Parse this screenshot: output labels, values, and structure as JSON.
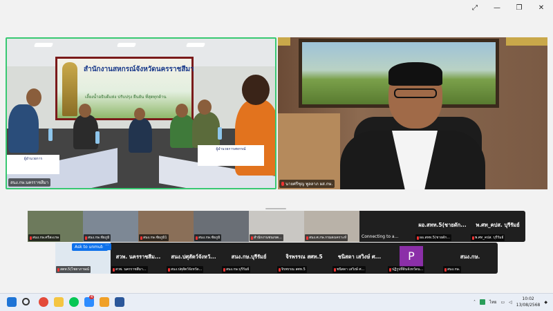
{
  "window": {
    "controls": [
      "⤢",
      "—",
      "❐",
      "✕"
    ]
  },
  "main_tiles": {
    "left": {
      "label": "สนง.กษ.นครราชสีมา",
      "banner_title": "สำนักงานสหกรณ์จังหวัดนครราชสีมา",
      "banner_sub": "เลี้ยงน้ำอธิบดีแห่ง  ปรับปรุง  ยืนยัน  ที่สุดทุกด้าน",
      "nameplate_1": "ผู้อำนวยการ",
      "nameplate_2": "ผู้อำนวยการสหกรณ์"
    },
    "right": {
      "label": "นายศรีชุญ พูลลาภ ผส.กษ."
    }
  },
  "strip_top": [
    {
      "label": "สนง.กษ.ศรีสะเกษ",
      "kind": "video",
      "color": "#6d7a5c"
    },
    {
      "label": "สนง.กษ.ชัยภูมิ",
      "kind": "video",
      "color": "#7d8895"
    },
    {
      "label": "สนง.กษ.ชัยภูมิ1",
      "kind": "video",
      "color": "#8a6f58"
    },
    {
      "label": "สนง.กษ.ชัยภูมิ",
      "kind": "video",
      "color": "#6a6f76"
    },
    {
      "label": "สำนักงานชนเขต...",
      "kind": "video",
      "color": "#c9c7c3"
    },
    {
      "label": "สนง.ศ.กษ.กรมสงเคราะห์",
      "kind": "video",
      "color": "#b9b2a8"
    },
    {
      "name": "",
      "label": "Connecting to a...",
      "kind": "connecting"
    },
    {
      "name": "ผอ.สทท.5(ชายดัก...",
      "label": "ผอ.สทท.5(ชายดัก...",
      "kind": "name"
    },
    {
      "name": "พ.ศท_คปส. บุรีรัมย์",
      "label": "พ.ศท_คปส. บุรีรัมย์",
      "kind": "name"
    }
  ],
  "strip_bottom": [
    {
      "label": "สตท.5(ไชยาภาษณ์",
      "kind": "video",
      "color": "#dfe8f0"
    },
    {
      "name": "สวพ. นครราชสีม...",
      "label": "สวพ. นครราชสีมา...",
      "kind": "name"
    },
    {
      "name": "สนง.ปศุสัตว์จังหวั...",
      "label": "สนง.ปศุสัตว์จังหวัด...",
      "kind": "name"
    },
    {
      "name": "สนง.กษ.บุรีรัมย์",
      "label": "สนง.กษ.บุรีรัมย์",
      "kind": "name"
    },
    {
      "name": "จิรพรรณ สศท.5",
      "label": "จิรพรรณ สศท.5",
      "kind": "name"
    },
    {
      "name": "ชนิสดา เสวิงษ์ ศ...",
      "label": "ชนิสดา เสวิงษ์ ศ...",
      "kind": "name"
    },
    {
      "name": "",
      "label": "ปฏิรูปที่ดินจังหวัดน...",
      "kind": "avatar",
      "initial": "P"
    },
    {
      "name": "สนง.กษ.",
      "label": "สนง.กษ.",
      "kind": "name"
    }
  ],
  "unmute": {
    "label": "Ask to unmute",
    "more": "···"
  },
  "taskbar": {
    "badge": "4",
    "tray_lang": "ไทย",
    "time": "10:02",
    "date": "13/08/2568"
  }
}
